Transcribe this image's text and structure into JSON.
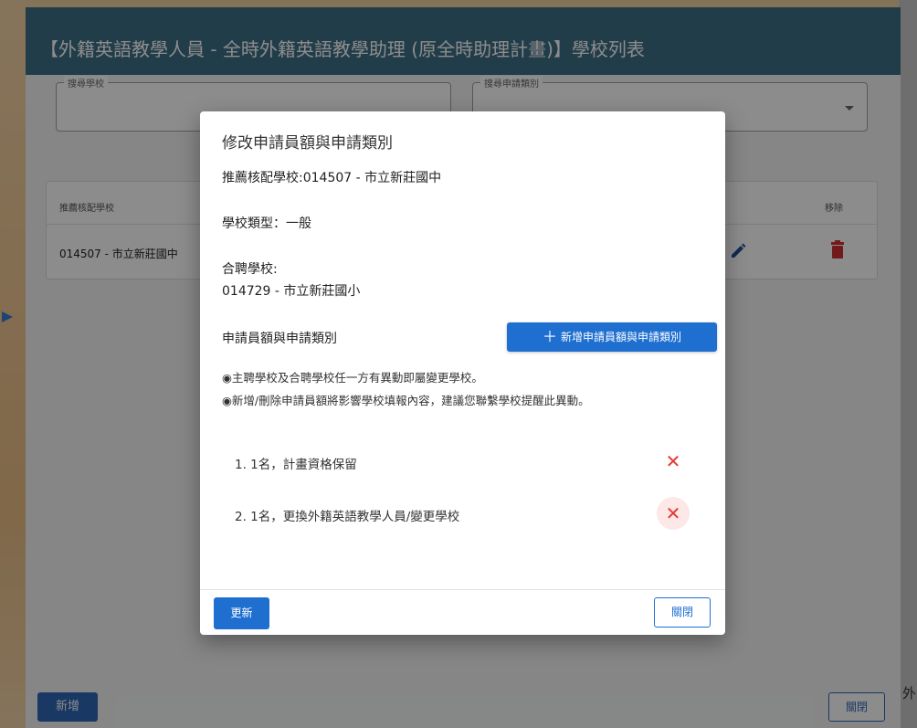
{
  "outer": {
    "title": "【外籍英語教學人員 - 全時外籍英語教學助理 (原全時助理計畫)】學校列表",
    "search_school_label": "搜尋學校",
    "search_category_label": "搜尋申請類別",
    "table_header_school": "推薦核配學校",
    "table_header_remove": "移除",
    "row_school": "014507 - 市立新莊國中",
    "add_label": "新增",
    "close_label": "關閉"
  },
  "background": {
    "side_text": "外"
  },
  "modal": {
    "title": "修改申請員額與申請類別",
    "recommended_school": "推薦核配學校:014507 - 市立新莊國中",
    "school_type": "學校類型：一般",
    "joint_label": "合聘學校:",
    "joint_school": "014729 - 市立新莊國小",
    "quota_label": "申請員額與申請類別",
    "add_quota_label": "新增申請員額與申請類別",
    "note1": "◉主聘學校及合聘學校任一方有異動即屬變更學校。",
    "note2": "◉新增/刪除申請員額將影響學校填報內容，建議您聯繫學校提醒此異動。",
    "items": [
      {
        "label": "1. 1名，計畫資格保留"
      },
      {
        "label": "2. 1名，更換外籍英語教學人員/變更學校"
      }
    ],
    "update_label": "更新",
    "close_label": "關閉"
  },
  "colors": {
    "primary": "#1f6fd0",
    "header": "#3f6f88",
    "danger": "#e53935"
  }
}
